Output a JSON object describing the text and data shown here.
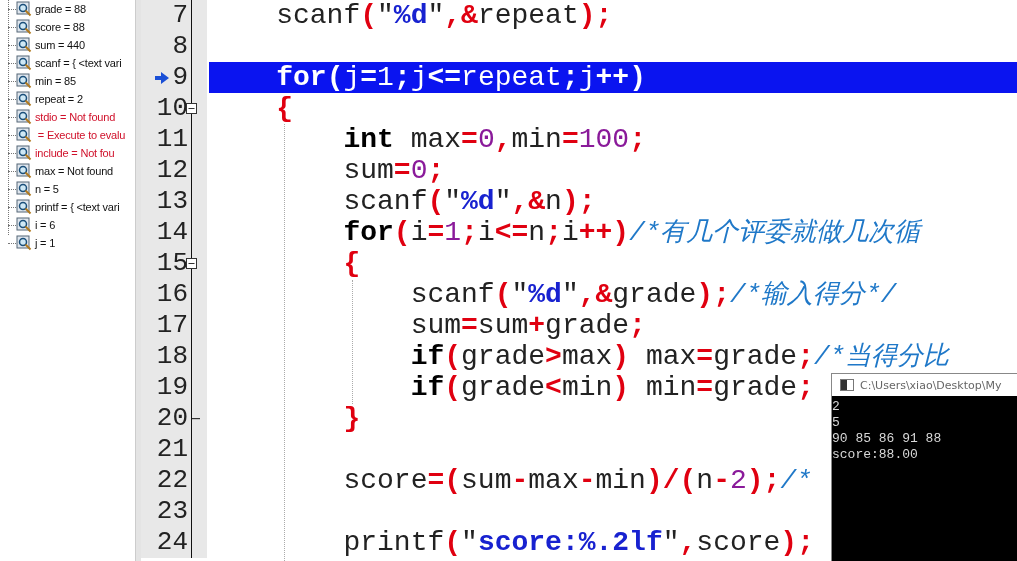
{
  "watches": [
    {
      "text": "grade = 88",
      "error": false
    },
    {
      "text": "score = 88",
      "error": false
    },
    {
      "text": "sum = 440",
      "error": false
    },
    {
      "text": "scanf = { <text vari",
      "error": false
    },
    {
      "text": "min = 85",
      "error": false
    },
    {
      "text": "repeat = 2",
      "error": false
    },
    {
      "text": "stdio = Not found",
      "error": true
    },
    {
      "text": " = Execute to evalu",
      "error": true
    },
    {
      "text": "include = Not fou",
      "error": true
    },
    {
      "text": "max = Not found",
      "error": false
    },
    {
      "text": "n = 5",
      "error": false
    },
    {
      "text": "printf = { <text vari",
      "error": false
    },
    {
      "text": "i = 6",
      "error": false
    },
    {
      "text": "j = 1",
      "error": false
    }
  ],
  "editor": {
    "lines": [
      {
        "number": "7",
        "current": false,
        "kind": "plain",
        "tokens": [
          {
            "t": "    scanf",
            "kind": "plain"
          },
          {
            "t": "(",
            "kind": "op"
          },
          {
            "t": "\"",
            "kind": "plain"
          },
          {
            "t": "%d",
            "kind": "str"
          },
          {
            "t": "\"",
            "kind": "plain"
          },
          {
            "t": ",&",
            "kind": "op"
          },
          {
            "t": "repeat",
            "kind": "plain"
          },
          {
            "t": ");",
            "kind": "op"
          }
        ]
      },
      {
        "number": "8",
        "current": false,
        "kind": "plain"
      },
      {
        "number": "9",
        "current": true,
        "kind": "plain",
        "tokens": [
          {
            "t": "    for",
            "kind": "kw"
          },
          {
            "t": "(",
            "kind": "op"
          },
          {
            "t": "j",
            "kind": "plain"
          },
          {
            "t": "=",
            "kind": "op"
          },
          {
            "t": "1",
            "kind": "num"
          },
          {
            "t": ";",
            "kind": "op"
          },
          {
            "t": "j",
            "kind": "plain"
          },
          {
            "t": "<=",
            "kind": "op"
          },
          {
            "t": "repeat",
            "kind": "plain"
          },
          {
            "t": ";",
            "kind": "op"
          },
          {
            "t": "j",
            "kind": "plain"
          },
          {
            "t": "++)",
            "kind": "op"
          }
        ]
      },
      {
        "number": "10",
        "current": false,
        "kind": "fold_start",
        "tokens": [
          {
            "t": "    {",
            "kind": "op"
          }
        ]
      },
      {
        "number": "11",
        "current": false,
        "kind": "plain",
        "tokens": [
          {
            "t": "        int",
            "kind": "kw"
          },
          {
            "t": " max",
            "kind": "plain"
          },
          {
            "t": "=",
            "kind": "op"
          },
          {
            "t": "0",
            "kind": "num"
          },
          {
            "t": ",",
            "kind": "op"
          },
          {
            "t": "min",
            "kind": "plain"
          },
          {
            "t": "=",
            "kind": "op"
          },
          {
            "t": "100",
            "kind": "num"
          },
          {
            "t": ";",
            "kind": "op"
          }
        ]
      },
      {
        "number": "12",
        "current": false,
        "kind": "plain",
        "tokens": [
          {
            "t": "        sum",
            "kind": "plain"
          },
          {
            "t": "=",
            "kind": "op"
          },
          {
            "t": "0",
            "kind": "num"
          },
          {
            "t": ";",
            "kind": "op"
          }
        ]
      },
      {
        "number": "13",
        "current": false,
        "kind": "plain",
        "tokens": [
          {
            "t": "        scanf",
            "kind": "plain"
          },
          {
            "t": "(",
            "kind": "op"
          },
          {
            "t": "\"",
            "kind": "plain"
          },
          {
            "t": "%d",
            "kind": "str"
          },
          {
            "t": "\"",
            "kind": "plain"
          },
          {
            "t": ",&",
            "kind": "op"
          },
          {
            "t": "n",
            "kind": "plain"
          },
          {
            "t": ");",
            "kind": "op"
          }
        ]
      },
      {
        "number": "14",
        "current": false,
        "kind": "plain",
        "tokens": [
          {
            "t": "        for",
            "kind": "kw"
          },
          {
            "t": "(",
            "kind": "op"
          },
          {
            "t": "i",
            "kind": "plain"
          },
          {
            "t": "=",
            "kind": "op"
          },
          {
            "t": "1",
            "kind": "num"
          },
          {
            "t": ";",
            "kind": "op"
          },
          {
            "t": "i",
            "kind": "plain"
          },
          {
            "t": "<=",
            "kind": "op"
          },
          {
            "t": "n",
            "kind": "plain"
          },
          {
            "t": ";",
            "kind": "op"
          },
          {
            "t": "i",
            "kind": "plain"
          },
          {
            "t": "++)",
            "kind": "op"
          },
          {
            "t": "/*有几个评委就做几次循",
            "kind": "comment"
          }
        ]
      },
      {
        "number": "15",
        "current": false,
        "kind": "fold_start",
        "tokens": [
          {
            "t": "        {",
            "kind": "op"
          }
        ]
      },
      {
        "number": "16",
        "current": false,
        "kind": "plain",
        "tokens": [
          {
            "t": "            scanf",
            "kind": "plain"
          },
          {
            "t": "(",
            "kind": "op"
          },
          {
            "t": "\"",
            "kind": "plain"
          },
          {
            "t": "%d",
            "kind": "str"
          },
          {
            "t": "\"",
            "kind": "plain"
          },
          {
            "t": ",&",
            "kind": "op"
          },
          {
            "t": "grade",
            "kind": "plain"
          },
          {
            "t": ");",
            "kind": "op"
          },
          {
            "t": "/*输入得分*/",
            "kind": "comment"
          }
        ]
      },
      {
        "number": "17",
        "current": false,
        "kind": "plain",
        "tokens": [
          {
            "t": "            sum",
            "kind": "plain"
          },
          {
            "t": "=",
            "kind": "op"
          },
          {
            "t": "sum",
            "kind": "plain"
          },
          {
            "t": "+",
            "kind": "op"
          },
          {
            "t": "grade",
            "kind": "plain"
          },
          {
            "t": ";",
            "kind": "op"
          }
        ]
      },
      {
        "number": "18",
        "current": false,
        "kind": "plain",
        "tokens": [
          {
            "t": "            if",
            "kind": "kw"
          },
          {
            "t": "(",
            "kind": "op"
          },
          {
            "t": "grade",
            "kind": "plain"
          },
          {
            "t": ">",
            "kind": "op"
          },
          {
            "t": "max",
            "kind": "plain"
          },
          {
            "t": ")",
            "kind": "op"
          },
          {
            "t": " max",
            "kind": "plain"
          },
          {
            "t": "=",
            "kind": "op"
          },
          {
            "t": "grade",
            "kind": "plain"
          },
          {
            "t": ";",
            "kind": "op"
          },
          {
            "t": "/*当得分比",
            "kind": "comment"
          }
        ]
      },
      {
        "number": "19",
        "current": false,
        "kind": "plain",
        "tokens": [
          {
            "t": "            if",
            "kind": "kw"
          },
          {
            "t": "(",
            "kind": "op"
          },
          {
            "t": "grade",
            "kind": "plain"
          },
          {
            "t": "<",
            "kind": "op"
          },
          {
            "t": "min",
            "kind": "plain"
          },
          {
            "t": ")",
            "kind": "op"
          },
          {
            "t": " min",
            "kind": "plain"
          },
          {
            "t": "=",
            "kind": "op"
          },
          {
            "t": "grade",
            "kind": "plain"
          },
          {
            "t": ";",
            "kind": "op"
          }
        ]
      },
      {
        "number": "20",
        "current": false,
        "kind": "fold_end",
        "tokens": [
          {
            "t": "        }",
            "kind": "op"
          }
        ]
      },
      {
        "number": "21",
        "current": false,
        "kind": "plain"
      },
      {
        "number": "22",
        "current": false,
        "kind": "plain",
        "tokens": [
          {
            "t": "        score",
            "kind": "plain"
          },
          {
            "t": "=(",
            "kind": "op"
          },
          {
            "t": "sum",
            "kind": "plain"
          },
          {
            "t": "-",
            "kind": "op"
          },
          {
            "t": "max",
            "kind": "plain"
          },
          {
            "t": "-",
            "kind": "op"
          },
          {
            "t": "min",
            "kind": "plain"
          },
          {
            "t": ")/(",
            "kind": "op"
          },
          {
            "t": "n",
            "kind": "plain"
          },
          {
            "t": "-",
            "kind": "op"
          },
          {
            "t": "2",
            "kind": "num"
          },
          {
            "t": ");",
            "kind": "op"
          },
          {
            "t": "/*",
            "kind": "comment"
          }
        ]
      },
      {
        "number": "23",
        "current": false,
        "kind": "plain"
      },
      {
        "number": "24",
        "current": false,
        "kind": "plain",
        "tokens": [
          {
            "t": "        printf",
            "kind": "plain"
          },
          {
            "t": "(",
            "kind": "op"
          },
          {
            "t": "\"",
            "kind": "plain"
          },
          {
            "t": "score:%.2lf",
            "kind": "str"
          },
          {
            "t": "\"",
            "kind": "plain"
          },
          {
            "t": ",",
            "kind": "op"
          },
          {
            "t": "score",
            "kind": "plain"
          },
          {
            "t": ");",
            "kind": "op"
          }
        ]
      }
    ]
  },
  "console": {
    "title": "C:\\Users\\xiao\\Desktop\\My",
    "output": [
      "2",
      "5",
      "90 85 86 91 88",
      "score:88.00"
    ]
  }
}
